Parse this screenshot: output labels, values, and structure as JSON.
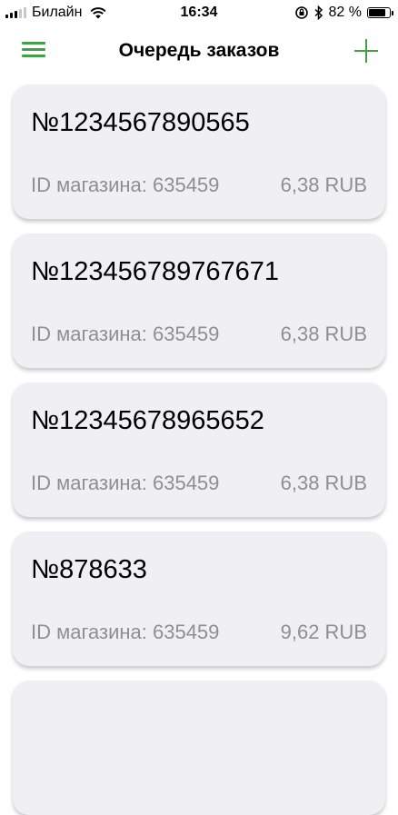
{
  "status_bar": {
    "carrier": "Билайн",
    "time": "16:34",
    "battery": "82 %",
    "battery_level": 0.82
  },
  "header": {
    "title": "Очередь заказов",
    "accent_color": "#43a047"
  },
  "orders": [
    {
      "number": "№1234567890565",
      "store": "ID магазина: 635459",
      "amount": "6,38 RUB"
    },
    {
      "number": "№123456789767671",
      "store": "ID магазина: 635459",
      "amount": "6,38 RUB"
    },
    {
      "number": "№12345678965652",
      "store": "ID магазина: 635459",
      "amount": "6,38 RUB"
    },
    {
      "number": "№878633",
      "store": "ID магазина: 635459",
      "amount": "9,62 RUB"
    }
  ]
}
